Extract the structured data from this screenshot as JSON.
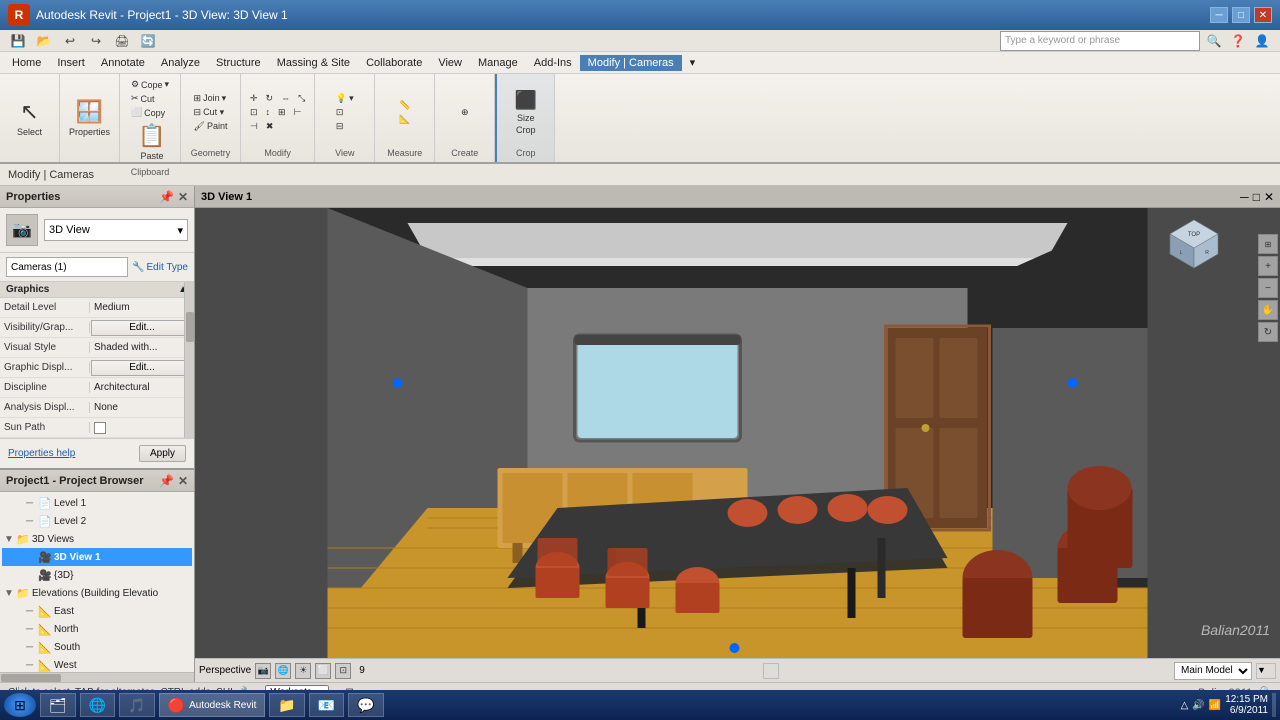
{
  "window": {
    "title": "Autodesk Revit - Project1 - 3D View: 3D View 1",
    "controls": [
      "─",
      "□",
      "✕"
    ]
  },
  "quickaccess": {
    "buttons": [
      "💾",
      "↩",
      "↪",
      "✂",
      "📋"
    ]
  },
  "menubar": {
    "items": [
      "Home",
      "Insert",
      "Annotate",
      "Analyze",
      "Structure",
      "Massing & Site",
      "Collaborate",
      "View",
      "Manage",
      "Add-Ins",
      "Modify | Cameras"
    ],
    "active_index": 10
  },
  "ribbon": {
    "select_label": "Select",
    "properties_label": "Properties",
    "modify_label": "Modify",
    "clipboard_label": "Clipboard",
    "geometry_label": "Geometry",
    "modify2_label": "Modify",
    "view_label": "View",
    "measure_label": "Measure",
    "create_label": "Create",
    "crop_label": "Crop",
    "cope_label": "Cope",
    "copy_label": "Copy",
    "cut_label": "Cut",
    "paste_label": "Paste",
    "join_label": "Join",
    "size_label": "Size",
    "crop2_label": "Crop"
  },
  "breadcrumb": {
    "text": "Modify | Cameras"
  },
  "properties": {
    "header": "Properties",
    "type": "3D View",
    "type_icon": "📷",
    "instance_label": "Cameras (1)",
    "edit_type_label": "Edit Type",
    "sections": {
      "graphics": {
        "label": "Graphics",
        "detail_level_label": "Detail Level",
        "detail_level_value": "Medium",
        "visibility_label": "Visibility/Grap...",
        "visibility_value": "Edit...",
        "visual_style_label": "Visual Style",
        "visual_style_value": "Shaded with...",
        "graphic_displ_label": "Graphic Displ...",
        "graphic_displ_value": "Edit...",
        "discipline_label": "Discipline",
        "discipline_value": "Architectural",
        "analysis_label": "Analysis Displ...",
        "analysis_value": "None",
        "sun_path_label": "Sun Path",
        "sun_path_value": ""
      }
    },
    "help_link": "Properties help",
    "apply_label": "Apply"
  },
  "project_browser": {
    "header": "Project1 - Project Browser",
    "tree": [
      {
        "level": 1,
        "label": "Level 1",
        "type": "item"
      },
      {
        "level": 1,
        "label": "Level 2",
        "type": "item"
      },
      {
        "level": 0,
        "label": "3D Views",
        "type": "group",
        "expanded": true
      },
      {
        "level": 2,
        "label": "3D View 1",
        "type": "item",
        "selected": true,
        "bold": true
      },
      {
        "level": 2,
        "label": "{3D}",
        "type": "item"
      },
      {
        "level": 0,
        "label": "Elevations (Building Elevatio",
        "type": "group",
        "expanded": true
      },
      {
        "level": 2,
        "label": "East",
        "type": "item"
      },
      {
        "level": 2,
        "label": "North",
        "type": "item"
      },
      {
        "level": 2,
        "label": "South",
        "type": "item"
      },
      {
        "level": 2,
        "label": "West",
        "type": "item"
      }
    ]
  },
  "viewport": {
    "perspective_label": "Perspective",
    "model_label": "Main Model",
    "watermark": "Balian2011"
  },
  "statusbar": {
    "text": "Click to select, TAB for alternates, CTRL adds, SHI",
    "icon": "🔧"
  },
  "taskbar": {
    "start_icon": "⊞",
    "items": [
      {
        "icon": "🗂",
        "label": ""
      },
      {
        "icon": "🌐",
        "label": ""
      },
      {
        "icon": "🎵",
        "label": ""
      },
      {
        "icon": "🔴",
        "label": "Autodesk Revit"
      },
      {
        "icon": "📁",
        "label": ""
      },
      {
        "icon": "📧",
        "label": ""
      },
      {
        "icon": "💬",
        "label": ""
      }
    ],
    "tray": {
      "icons": [
        "△",
        "🔊",
        "🌐"
      ],
      "time": "12:15 PM",
      "date": "6/9/2011"
    }
  }
}
